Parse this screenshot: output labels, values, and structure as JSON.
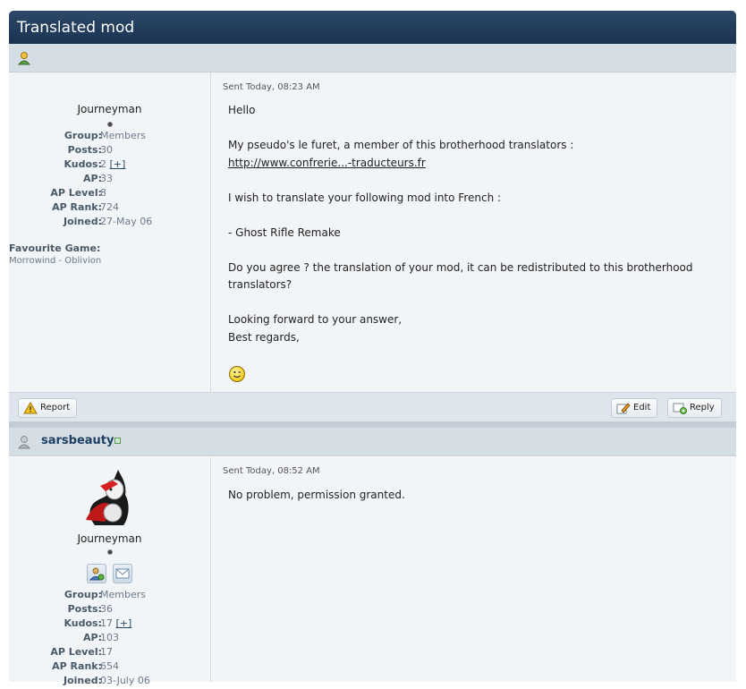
{
  "topic": {
    "title": "Translated mod"
  },
  "post1": {
    "author": {
      "rank": "Journeyman",
      "info": [
        {
          "label": "Group:",
          "value": "Members"
        },
        {
          "label": "Posts:",
          "value": "30"
        },
        {
          "label": "Kudos:",
          "value": "2",
          "plus": "[+]"
        },
        {
          "label": "AP:",
          "value": "33"
        },
        {
          "label": "AP Level:",
          "value": "8"
        },
        {
          "label": "AP Rank:",
          "value": "724"
        },
        {
          "label": "Joined:",
          "value": "27-May 06"
        }
      ],
      "favourite_label": "Favourite Game:",
      "favourite_value": "Morrowind - Oblivion"
    },
    "sent": "Sent Today, 08:23 AM",
    "lines": [
      "Hello",
      "",
      "My pseudo's le furet, a member of this brotherhood translators :",
      "",
      "",
      "I wish to translate your following mod into French :",
      "",
      "- Ghost Rifle Remake",
      "",
      "Do you agree ? the translation of your mod, it can be redistributed to this brotherhood",
      "translators?",
      "",
      "Looking forward to your answer,",
      "Best regards,"
    ],
    "link": "http://www.confrerie...-traducteurs.fr"
  },
  "actions": {
    "report": "Report",
    "edit": "Edit",
    "reply": "Reply"
  },
  "post2": {
    "author_name": "sarsbeauty",
    "author": {
      "rank": "Journeyman",
      "info": [
        {
          "label": "Group:",
          "value": "Members"
        },
        {
          "label": "Posts:",
          "value": "36"
        },
        {
          "label": "Kudos:",
          "value": "17",
          "plus": "[+]"
        },
        {
          "label": "AP:",
          "value": "103"
        },
        {
          "label": "AP Level:",
          "value": "17"
        },
        {
          "label": "AP Rank:",
          "value": "654"
        },
        {
          "label": "Joined:",
          "value": "03-July 06"
        }
      ]
    },
    "sent": "Sent Today, 08:52 AM",
    "message": "No problem, permission granted."
  },
  "colors": {
    "header": "#1b3352",
    "bar": "#d5dde5",
    "body": "#f2f5f8",
    "name": "#1d3f62"
  },
  "icons": [
    "user-icon",
    "report-icon",
    "edit-icon",
    "reply-icon",
    "avatar-image",
    "add-friend-icon",
    "message-icon"
  ]
}
